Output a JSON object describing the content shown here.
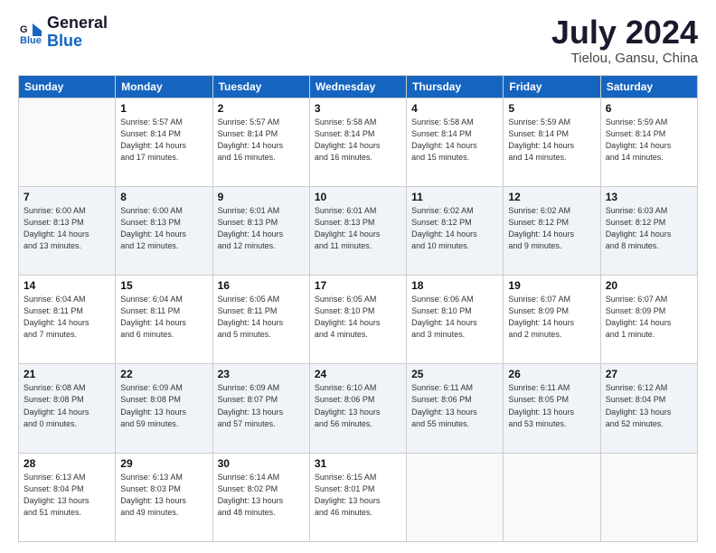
{
  "logo": {
    "line1": "General",
    "line2": "Blue"
  },
  "title": "July 2024",
  "location": "Tielou, Gansu, China",
  "headers": [
    "Sunday",
    "Monday",
    "Tuesday",
    "Wednesday",
    "Thursday",
    "Friday",
    "Saturday"
  ],
  "weeks": [
    [
      {
        "day": "",
        "info": ""
      },
      {
        "day": "1",
        "info": "Sunrise: 5:57 AM\nSunset: 8:14 PM\nDaylight: 14 hours\nand 17 minutes."
      },
      {
        "day": "2",
        "info": "Sunrise: 5:57 AM\nSunset: 8:14 PM\nDaylight: 14 hours\nand 16 minutes."
      },
      {
        "day": "3",
        "info": "Sunrise: 5:58 AM\nSunset: 8:14 PM\nDaylight: 14 hours\nand 16 minutes."
      },
      {
        "day": "4",
        "info": "Sunrise: 5:58 AM\nSunset: 8:14 PM\nDaylight: 14 hours\nand 15 minutes."
      },
      {
        "day": "5",
        "info": "Sunrise: 5:59 AM\nSunset: 8:14 PM\nDaylight: 14 hours\nand 14 minutes."
      },
      {
        "day": "6",
        "info": "Sunrise: 5:59 AM\nSunset: 8:14 PM\nDaylight: 14 hours\nand 14 minutes."
      }
    ],
    [
      {
        "day": "7",
        "info": "Sunrise: 6:00 AM\nSunset: 8:13 PM\nDaylight: 14 hours\nand 13 minutes."
      },
      {
        "day": "8",
        "info": "Sunrise: 6:00 AM\nSunset: 8:13 PM\nDaylight: 14 hours\nand 12 minutes."
      },
      {
        "day": "9",
        "info": "Sunrise: 6:01 AM\nSunset: 8:13 PM\nDaylight: 14 hours\nand 12 minutes."
      },
      {
        "day": "10",
        "info": "Sunrise: 6:01 AM\nSunset: 8:13 PM\nDaylight: 14 hours\nand 11 minutes."
      },
      {
        "day": "11",
        "info": "Sunrise: 6:02 AM\nSunset: 8:12 PM\nDaylight: 14 hours\nand 10 minutes."
      },
      {
        "day": "12",
        "info": "Sunrise: 6:02 AM\nSunset: 8:12 PM\nDaylight: 14 hours\nand 9 minutes."
      },
      {
        "day": "13",
        "info": "Sunrise: 6:03 AM\nSunset: 8:12 PM\nDaylight: 14 hours\nand 8 minutes."
      }
    ],
    [
      {
        "day": "14",
        "info": "Sunrise: 6:04 AM\nSunset: 8:11 PM\nDaylight: 14 hours\nand 7 minutes."
      },
      {
        "day": "15",
        "info": "Sunrise: 6:04 AM\nSunset: 8:11 PM\nDaylight: 14 hours\nand 6 minutes."
      },
      {
        "day": "16",
        "info": "Sunrise: 6:05 AM\nSunset: 8:11 PM\nDaylight: 14 hours\nand 5 minutes."
      },
      {
        "day": "17",
        "info": "Sunrise: 6:05 AM\nSunset: 8:10 PM\nDaylight: 14 hours\nand 4 minutes."
      },
      {
        "day": "18",
        "info": "Sunrise: 6:06 AM\nSunset: 8:10 PM\nDaylight: 14 hours\nand 3 minutes."
      },
      {
        "day": "19",
        "info": "Sunrise: 6:07 AM\nSunset: 8:09 PM\nDaylight: 14 hours\nand 2 minutes."
      },
      {
        "day": "20",
        "info": "Sunrise: 6:07 AM\nSunset: 8:09 PM\nDaylight: 14 hours\nand 1 minute."
      }
    ],
    [
      {
        "day": "21",
        "info": "Sunrise: 6:08 AM\nSunset: 8:08 PM\nDaylight: 14 hours\nand 0 minutes."
      },
      {
        "day": "22",
        "info": "Sunrise: 6:09 AM\nSunset: 8:08 PM\nDaylight: 13 hours\nand 59 minutes."
      },
      {
        "day": "23",
        "info": "Sunrise: 6:09 AM\nSunset: 8:07 PM\nDaylight: 13 hours\nand 57 minutes."
      },
      {
        "day": "24",
        "info": "Sunrise: 6:10 AM\nSunset: 8:06 PM\nDaylight: 13 hours\nand 56 minutes."
      },
      {
        "day": "25",
        "info": "Sunrise: 6:11 AM\nSunset: 8:06 PM\nDaylight: 13 hours\nand 55 minutes."
      },
      {
        "day": "26",
        "info": "Sunrise: 6:11 AM\nSunset: 8:05 PM\nDaylight: 13 hours\nand 53 minutes."
      },
      {
        "day": "27",
        "info": "Sunrise: 6:12 AM\nSunset: 8:04 PM\nDaylight: 13 hours\nand 52 minutes."
      }
    ],
    [
      {
        "day": "28",
        "info": "Sunrise: 6:13 AM\nSunset: 8:04 PM\nDaylight: 13 hours\nand 51 minutes."
      },
      {
        "day": "29",
        "info": "Sunrise: 6:13 AM\nSunset: 8:03 PM\nDaylight: 13 hours\nand 49 minutes."
      },
      {
        "day": "30",
        "info": "Sunrise: 6:14 AM\nSunset: 8:02 PM\nDaylight: 13 hours\nand 48 minutes."
      },
      {
        "day": "31",
        "info": "Sunrise: 6:15 AM\nSunset: 8:01 PM\nDaylight: 13 hours\nand 46 minutes."
      },
      {
        "day": "",
        "info": ""
      },
      {
        "day": "",
        "info": ""
      },
      {
        "day": "",
        "info": ""
      }
    ]
  ]
}
